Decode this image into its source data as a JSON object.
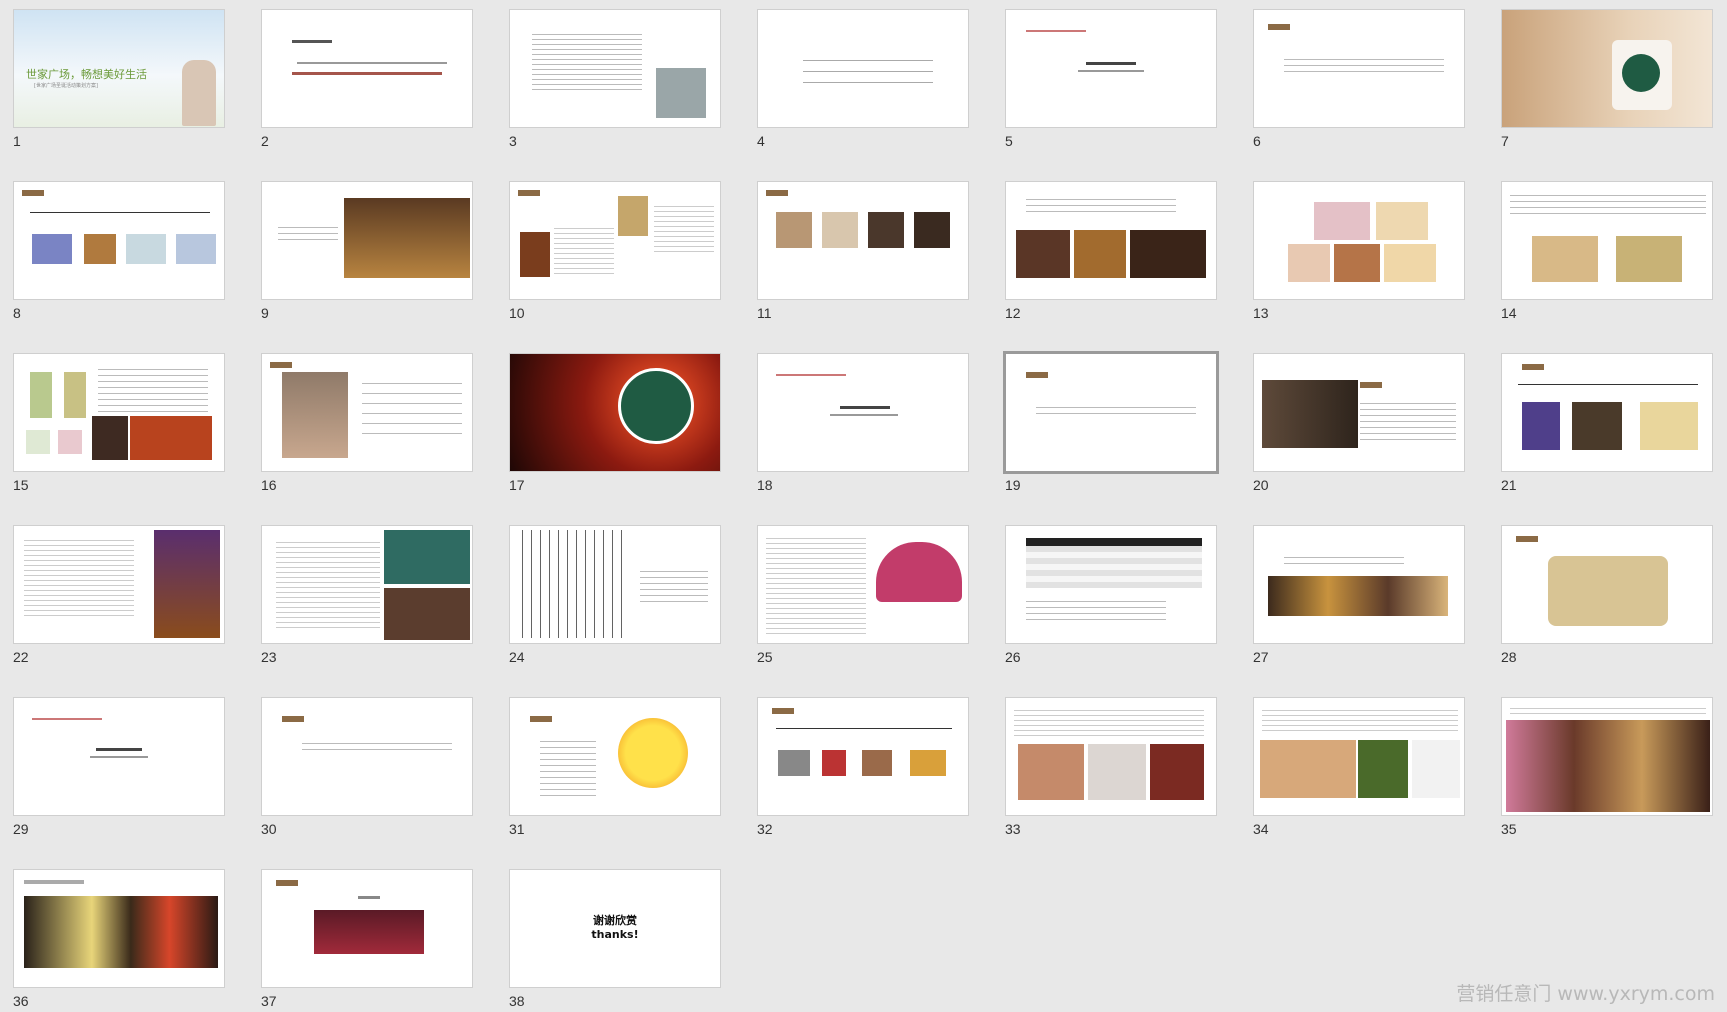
{
  "slide_numbers": [
    "1",
    "2",
    "3",
    "4",
    "5",
    "6",
    "7",
    "8",
    "9",
    "10",
    "11",
    "12",
    "13",
    "14",
    "15",
    "16",
    "17",
    "18",
    "19",
    "20",
    "21",
    "22",
    "23",
    "24",
    "25",
    "26",
    "27",
    "28",
    "29",
    "30",
    "31",
    "32",
    "33",
    "34",
    "35",
    "36",
    "37",
    "38"
  ],
  "slide1": {
    "title": "世家广场，畅想美好生活",
    "subtitle": "[世家广场圣诞活动策划方案]"
  },
  "slide38": {
    "line1": "谢谢欣赏",
    "line2": "thanks!"
  },
  "watermark": "营销任意门 www.yxrym.com",
  "selected_slide": "19"
}
